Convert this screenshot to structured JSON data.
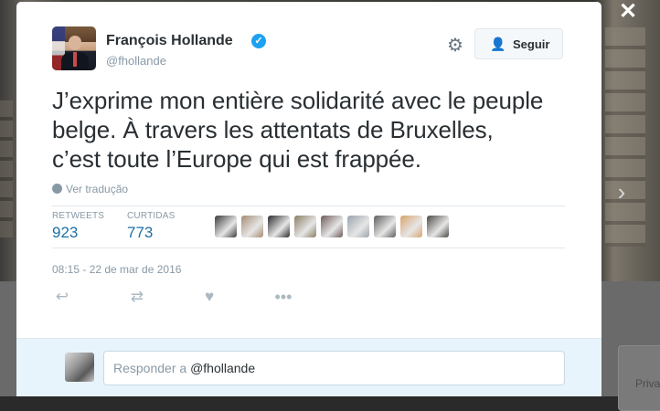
{
  "tweet": {
    "author_name": "François Hollande",
    "author_handle": "@fhollande",
    "follow_label": "Seguir",
    "text_lines": [
      "J’exprime mon entière solidarité avec le peuple",
      "belge. À travers les attentats de Bruxelles,",
      "c’est toute l’Europe qui est frappée."
    ],
    "translate_label": "Ver tradução",
    "retweets_label": "RETWEETS",
    "retweets_count": "923",
    "likes_label": "CURTIDAS",
    "likes_count": "773",
    "timestamp": "08:15 - 22 de mar de 2016"
  },
  "reply": {
    "prefix": "Responder a ",
    "mention": "@fhollande"
  },
  "side_card": {
    "text": "Priva"
  },
  "icons": {
    "close": "close-icon",
    "gear": "gear-icon",
    "follow": "add-user-icon",
    "verified": "verified-badge-icon",
    "translate": "globe-icon",
    "reply": "reply-icon",
    "retweet": "retweet-icon",
    "like": "heart-icon",
    "more": "more-icon",
    "next": "chevron-right-icon"
  },
  "colors": {
    "accent": "#1da1f2",
    "link": "#1d6fa5",
    "muted": "#8899a6",
    "text": "#292f33"
  },
  "likers": [
    "#3a3a3a",
    "#a58b72",
    "#2b2b2b",
    "#8a7d63",
    "#6f5a5a",
    "#9aa3ad",
    "#5d5d5d",
    "#d8a46c",
    "#4d4a45"
  ]
}
